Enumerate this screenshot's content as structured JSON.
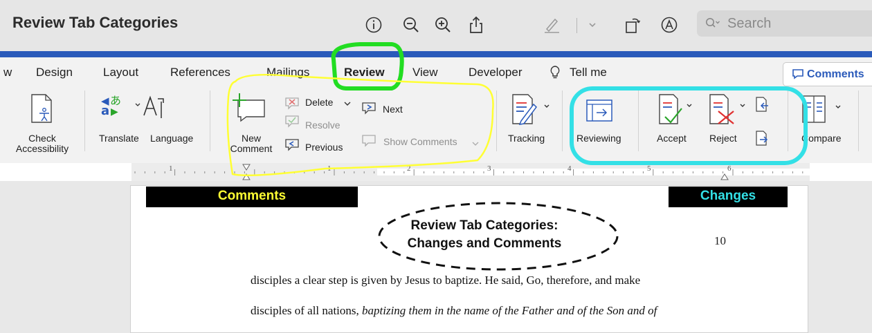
{
  "window": {
    "title": "Review Tab Categories",
    "search_placeholder": "Search"
  },
  "toolbar_icons": [
    "info-icon",
    "zoom-out-icon",
    "zoom-in-icon",
    "share-icon",
    "pen-icon",
    "chevron-down-icon",
    "rotate-icon",
    "markup-icon",
    "search-icon"
  ],
  "tabs": [
    {
      "label": "w"
    },
    {
      "label": "Design"
    },
    {
      "label": "Layout"
    },
    {
      "label": "References"
    },
    {
      "label": "Mailings"
    },
    {
      "label": "Review",
      "active": true
    },
    {
      "label": "View"
    },
    {
      "label": "Developer"
    },
    {
      "label": "Tell me"
    }
  ],
  "comments_button": "Comments",
  "ribbon": {
    "check_accessibility_1": "Check",
    "check_accessibility_2": "Accessibility",
    "translate": "Translate",
    "language": "Language",
    "new_comment_1": "New",
    "new_comment_2": "Comment",
    "delete": "Delete",
    "resolve": "Resolve",
    "previous": "Previous",
    "next": "Next",
    "show_comments": "Show Comments",
    "tracking": "Tracking",
    "reviewing": "Reviewing",
    "accept": "Accept",
    "reject": "Reject",
    "compare": "Compare"
  },
  "ruler": {
    "numbers": [
      "1",
      "1",
      "2",
      "3",
      "4",
      "5",
      "6"
    ]
  },
  "annotations": {
    "comments_label": "Comments",
    "changes_label": "Changes",
    "comments_color": "#ffff33",
    "changes_color": "#33e0e6",
    "review_circle_color": "#22dd22"
  },
  "document": {
    "heading_line1": "Review Tab Categories:",
    "heading_line2": "Changes and Comments",
    "page_number": "10",
    "line1": "disciples a clear step is given by Jesus to baptize. He said, Go, therefore, and make",
    "line2_normal": "disciples of all nations, ",
    "line2_italic": "baptizing them in the name of the Father and of the Son and of"
  },
  "colors": {
    "accent_blue": "#2a5aba",
    "titlebar_bg": "#e6e6e6",
    "ribbon_bg": "#f2f2f2",
    "accept_check": "#2aa52a",
    "reject_x": "#e03030"
  }
}
